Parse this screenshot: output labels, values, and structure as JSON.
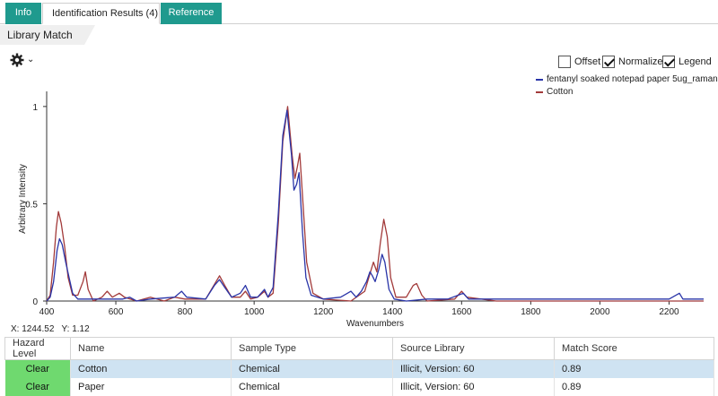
{
  "tabs": [
    {
      "label": "Info"
    },
    {
      "label": "Identification Results (4)"
    },
    {
      "label": "Reference"
    }
  ],
  "panel": {
    "title": "Library Match"
  },
  "options": {
    "offset": {
      "label": "Offset",
      "checked": false
    },
    "normalize": {
      "label": "Normalize",
      "checked": true
    },
    "legend": {
      "label": "Legend",
      "checked": true
    }
  },
  "cursor": {
    "x_label": "X: 1244.52",
    "y_label": "Y: 1.12"
  },
  "chart_data": {
    "type": "line",
    "xlabel": "Wavenumbers",
    "ylabel": "Arbitrary Intensity",
    "xlim": [
      400,
      2300
    ],
    "ylim": [
      0,
      1.05
    ],
    "x_ticks": [
      400,
      600,
      800,
      1000,
      1200,
      1400,
      1600,
      1800,
      2000,
      2200
    ],
    "y_ticks": [
      0,
      0.5,
      1
    ],
    "y_tick_labels": [
      "0",
      "0.5",
      "1"
    ],
    "legend_position": "top-right",
    "series": [
      {
        "name": "fentanyl soaked notepad paper 5ug_raman",
        "color": "#2a35a8",
        "points": [
          [
            400,
            0
          ],
          [
            410,
            0.02
          ],
          [
            420,
            0.1
          ],
          [
            430,
            0.26
          ],
          [
            437,
            0.32
          ],
          [
            445,
            0.29
          ],
          [
            455,
            0.2
          ],
          [
            465,
            0.12
          ],
          [
            475,
            0.04
          ],
          [
            490,
            0.01
          ],
          [
            520,
            0.01
          ],
          [
            560,
            0.01
          ],
          [
            620,
            0.01
          ],
          [
            640,
            0.02
          ],
          [
            660,
            0.0
          ],
          [
            700,
            0.01
          ],
          [
            770,
            0.02
          ],
          [
            790,
            0.05
          ],
          [
            805,
            0.02
          ],
          [
            860,
            0.01
          ],
          [
            885,
            0.08
          ],
          [
            900,
            0.11
          ],
          [
            915,
            0.07
          ],
          [
            935,
            0.02
          ],
          [
            960,
            0.04
          ],
          [
            975,
            0.08
          ],
          [
            990,
            0.02
          ],
          [
            1010,
            0.02
          ],
          [
            1030,
            0.06
          ],
          [
            1040,
            0.02
          ],
          [
            1055,
            0.07
          ],
          [
            1070,
            0.45
          ],
          [
            1083,
            0.85
          ],
          [
            1095,
            0.98
          ],
          [
            1108,
            0.75
          ],
          [
            1115,
            0.57
          ],
          [
            1123,
            0.6
          ],
          [
            1130,
            0.66
          ],
          [
            1140,
            0.35
          ],
          [
            1150,
            0.12
          ],
          [
            1165,
            0.03
          ],
          [
            1200,
            0.01
          ],
          [
            1250,
            0.02
          ],
          [
            1280,
            0.05
          ],
          [
            1295,
            0.02
          ],
          [
            1310,
            0.05
          ],
          [
            1325,
            0.1
          ],
          [
            1335,
            0.15
          ],
          [
            1342,
            0.13
          ],
          [
            1350,
            0.1
          ],
          [
            1360,
            0.16
          ],
          [
            1370,
            0.24
          ],
          [
            1378,
            0.2
          ],
          [
            1390,
            0.06
          ],
          [
            1405,
            0.01
          ],
          [
            1440,
            0.0
          ],
          [
            1500,
            0.01
          ],
          [
            1560,
            0.01
          ],
          [
            1590,
            0.03
          ],
          [
            1605,
            0.04
          ],
          [
            1620,
            0.01
          ],
          [
            1700,
            0.01
          ],
          [
            1800,
            0.01
          ],
          [
            1900,
            0.01
          ],
          [
            2000,
            0.01
          ],
          [
            2100,
            0.01
          ],
          [
            2200,
            0.01
          ],
          [
            2230,
            0.04
          ],
          [
            2240,
            0.01
          ],
          [
            2300,
            0.01
          ]
        ]
      },
      {
        "name": "Cotton",
        "color": "#a23a3a",
        "points": [
          [
            400,
            0
          ],
          [
            410,
            0.03
          ],
          [
            420,
            0.2
          ],
          [
            428,
            0.38
          ],
          [
            434,
            0.46
          ],
          [
            442,
            0.4
          ],
          [
            452,
            0.28
          ],
          [
            462,
            0.12
          ],
          [
            475,
            0.03
          ],
          [
            490,
            0.03
          ],
          [
            505,
            0.1
          ],
          [
            512,
            0.15
          ],
          [
            520,
            0.06
          ],
          [
            535,
            0.0
          ],
          [
            560,
            0.02
          ],
          [
            575,
            0.05
          ],
          [
            590,
            0.02
          ],
          [
            610,
            0.04
          ],
          [
            625,
            0.02
          ],
          [
            660,
            0.0
          ],
          [
            700,
            0.02
          ],
          [
            740,
            0.0
          ],
          [
            770,
            0.02
          ],
          [
            800,
            0.01
          ],
          [
            860,
            0.01
          ],
          [
            880,
            0.07
          ],
          [
            900,
            0.13
          ],
          [
            915,
            0.08
          ],
          [
            935,
            0.02
          ],
          [
            960,
            0.02
          ],
          [
            975,
            0.05
          ],
          [
            990,
            0.01
          ],
          [
            1010,
            0.02
          ],
          [
            1030,
            0.05
          ],
          [
            1040,
            0.02
          ],
          [
            1055,
            0.04
          ],
          [
            1070,
            0.4
          ],
          [
            1083,
            0.82
          ],
          [
            1097,
            1.0
          ],
          [
            1110,
            0.75
          ],
          [
            1118,
            0.63
          ],
          [
            1125,
            0.69
          ],
          [
            1132,
            0.76
          ],
          [
            1142,
            0.48
          ],
          [
            1152,
            0.2
          ],
          [
            1170,
            0.04
          ],
          [
            1200,
            0.01
          ],
          [
            1280,
            0.0
          ],
          [
            1320,
            0.05
          ],
          [
            1335,
            0.14
          ],
          [
            1345,
            0.2
          ],
          [
            1355,
            0.15
          ],
          [
            1365,
            0.3
          ],
          [
            1375,
            0.42
          ],
          [
            1385,
            0.33
          ],
          [
            1395,
            0.12
          ],
          [
            1410,
            0.02
          ],
          [
            1440,
            0.02
          ],
          [
            1460,
            0.08
          ],
          [
            1470,
            0.09
          ],
          [
            1485,
            0.03
          ],
          [
            1500,
            0.0
          ],
          [
            1580,
            0.01
          ],
          [
            1600,
            0.05
          ],
          [
            1615,
            0.02
          ],
          [
            1700,
            0.0
          ],
          [
            2300,
            0.0
          ]
        ]
      }
    ]
  },
  "table": {
    "columns": [
      "Hazard Level",
      "Name",
      "Sample Type",
      "Source Library",
      "Match Score"
    ],
    "rows": [
      {
        "hazard": "Clear",
        "name": "Cotton",
        "sample_type": "Chemical",
        "source": "Illicit, Version: 60",
        "score": "0.89"
      },
      {
        "hazard": "Clear",
        "name": "Paper",
        "sample_type": "Chemical",
        "source": "Illicit, Version: 60",
        "score": "0.89"
      }
    ]
  }
}
